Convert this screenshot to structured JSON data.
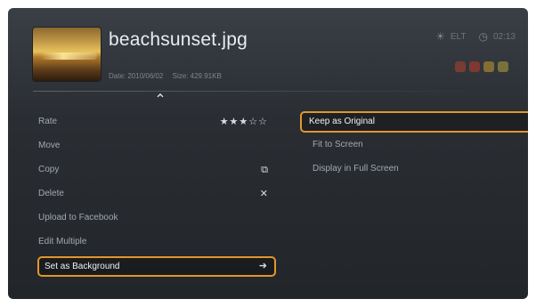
{
  "header": {
    "filename": "beachsunset.jpg",
    "date_label": "Date: 2010/06/02",
    "size_label": "Size: 429.91KB"
  },
  "status": {
    "brightness_icon": "sun-icon",
    "mode_text": "ELT",
    "clock_icon": "clock-icon",
    "time": "02:13"
  },
  "color_dots": [
    "#b5412a",
    "#c03a2a",
    "#c79a2a",
    "#b5a13a"
  ],
  "menu": {
    "items": [
      {
        "label": "Rate",
        "trail": "★★★☆☆"
      },
      {
        "label": "Move",
        "trail": ""
      },
      {
        "label": "Copy",
        "trail": "copy-icon"
      },
      {
        "label": "Delete",
        "trail": "✕"
      },
      {
        "label": "Upload to Facebook",
        "trail": ""
      },
      {
        "label": "Edit Multiple",
        "trail": ""
      },
      {
        "label": "Set as Background",
        "trail": "➜"
      }
    ],
    "selected": "Set as Background"
  },
  "submenu": {
    "items": [
      "Keep as Original",
      "Fit to Screen",
      "Display in Full Screen"
    ],
    "selected": "Keep as Original"
  },
  "accent_color": "#e3962c"
}
